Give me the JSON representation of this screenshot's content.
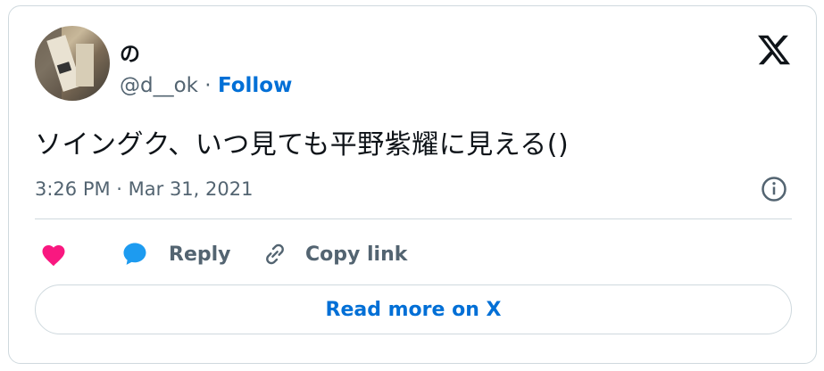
{
  "author": {
    "display_name": "の",
    "handle": "@d__ok",
    "separator": " · ",
    "follow_label": "Follow"
  },
  "tweet": {
    "text": "ソイングク、いつ見ても平野紫耀に見える()",
    "timestamp": "3:26 PM · Mar 31, 2021"
  },
  "actions": {
    "reply_label": "Reply",
    "copy_link_label": "Copy link"
  },
  "read_more_label": "Read more on X",
  "icons": {
    "platform": "x-logo-icon",
    "info": "info-icon",
    "like": "heart-icon",
    "reply": "speech-bubble-icon",
    "copy": "link-icon"
  },
  "colors": {
    "like": "#f91880",
    "reply": "#1d9bf0",
    "link": "#006fd6",
    "muted": "#536471",
    "text": "#0f1419",
    "border": "#cfd9de"
  }
}
